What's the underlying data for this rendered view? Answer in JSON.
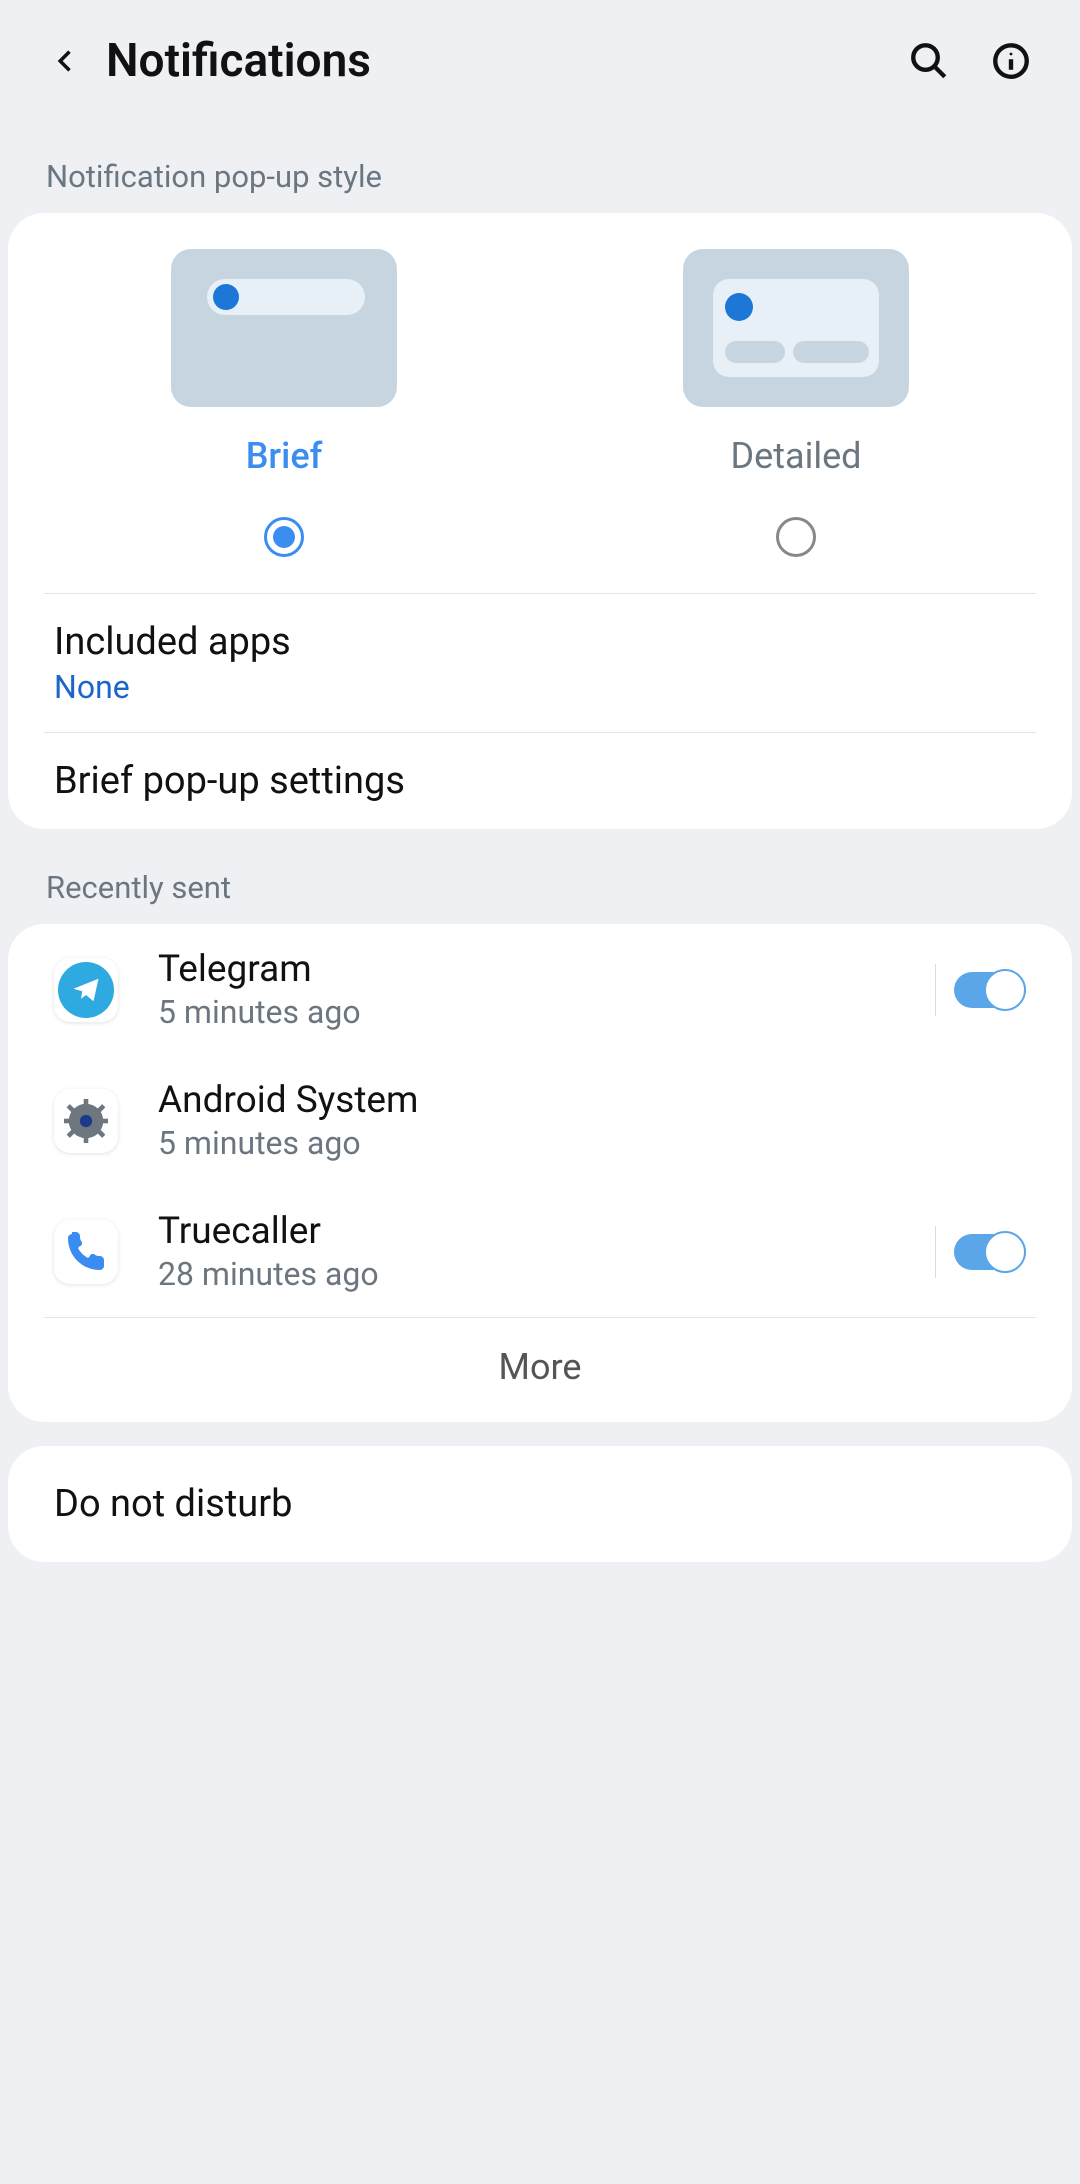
{
  "header": {
    "title": "Notifications"
  },
  "popup": {
    "section_label": "Notification pop-up style",
    "brief_label": "Brief",
    "detailed_label": "Detailed",
    "included_label": "Included apps",
    "included_value": "None",
    "brief_settings_label": "Brief pop-up settings"
  },
  "recent": {
    "section_label": "Recently sent",
    "items": [
      {
        "name": "Telegram",
        "time": "5 minutes ago"
      },
      {
        "name": "Android System",
        "time": "5 minutes ago"
      },
      {
        "name": "Truecaller",
        "time": "28 minutes ago"
      }
    ],
    "more_label": "More"
  },
  "dnd": {
    "label": "Do not disturb"
  }
}
